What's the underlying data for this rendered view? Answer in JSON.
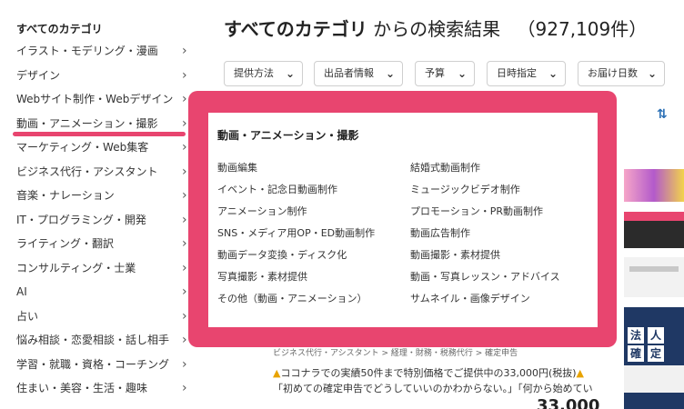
{
  "sidebar": {
    "heading": "すべてのカテゴリ",
    "items": [
      {
        "label": "イラスト・モデリング・漫画"
      },
      {
        "label": "デザイン"
      },
      {
        "label": "Webサイト制作・Webデザイン"
      },
      {
        "label": "動画・アニメーション・撮影"
      },
      {
        "label": "マーケティング・Web集客"
      },
      {
        "label": "ビジネス代行・アシスタント"
      },
      {
        "label": "音楽・ナレーション"
      },
      {
        "label": "IT・プログラミング・開発"
      },
      {
        "label": "ライティング・翻訳"
      },
      {
        "label": "コンサルティング・士業"
      },
      {
        "label": "AI"
      },
      {
        "label": "占い"
      },
      {
        "label": "悩み相談・恋愛相談・話し相手"
      },
      {
        "label": "学習・就職・資格・コーチング"
      },
      {
        "label": "住まい・美容・生活・趣味"
      }
    ],
    "active_index": 3,
    "chevron": "›"
  },
  "header": {
    "category": "すべてのカテゴリ",
    "suffix": "からの検索結果",
    "count": "（927,109件）"
  },
  "filters": [
    {
      "label": "提供方法"
    },
    {
      "label": "出品者情報"
    },
    {
      "label": "予算"
    },
    {
      "label": "日時指定"
    },
    {
      "label": "お届け日数"
    }
  ],
  "sort_icon": "sort-icon",
  "dropdown": {
    "title": "動画・アニメーション・撮影",
    "left": [
      "動画編集",
      "イベント・記念日動画制作",
      "アニメーション制作",
      "SNS・メディア用OP・ED動画制作",
      "動画データ変換・ディスク化",
      "写真撮影・素材提供",
      "その他（動画・アニメーション）"
    ],
    "right": [
      "結婚式動画制作",
      "ミュージックビデオ制作",
      "プロモーション・PR動画制作",
      "動画広告制作",
      "動画撮影・素材提供",
      "動画・写真レッスン・アドバイス",
      "サムネイル・画像デザイン"
    ],
    "accent_color": "#e8456f"
  },
  "listing": {
    "breadcrumb": "ビジネス代行・アシスタント > 経理・財務・税務代行 > 確定申告",
    "line1": "ココナラでの実績50件まで特別価格でご提供中の33,000円(税抜)",
    "line2": "「初めての確定申告でどうしていいのかわからない。」「何から始めてい",
    "price": "33,000"
  },
  "thumbnails": {
    "thumb4_chars": [
      "法",
      "人",
      "確",
      "定"
    ]
  }
}
